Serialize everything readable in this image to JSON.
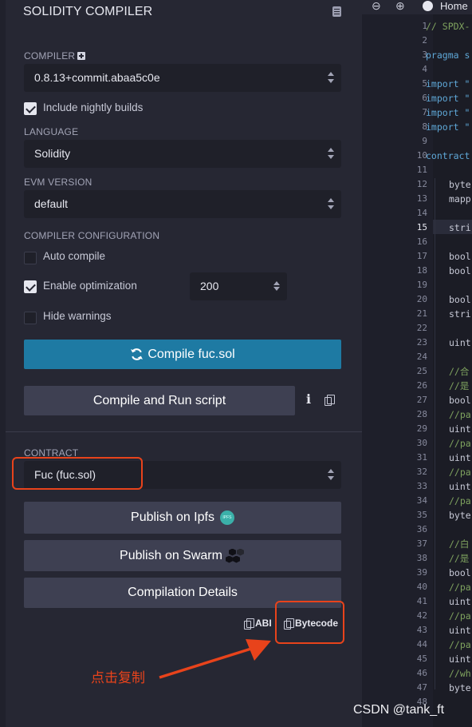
{
  "panel": {
    "title": "SOLIDITY COMPILER",
    "compiler_label": "COMPILER",
    "compiler_version": "0.8.13+commit.abaa5c0e",
    "include_nightly_label": "Include nightly builds",
    "language_label": "LANGUAGE",
    "language_value": "Solidity",
    "evm_label": "EVM VERSION",
    "evm_value": "default",
    "config_label": "COMPILER CONFIGURATION",
    "auto_compile_label": "Auto compile",
    "enable_optimization_label": "Enable optimization",
    "optimization_runs": "200",
    "hide_warnings_label": "Hide warnings",
    "compile_button": "Compile fuc.sol",
    "compile_run_button": "Compile and Run script",
    "info_icon_glyph": "i",
    "contract_label": "CONTRACT",
    "contract_value": "Fuc (fuc.sol)",
    "publish_ipfs_button": "Publish on Ipfs",
    "ipfs_badge_text": "IPFS",
    "publish_swarm_button": "Publish on Swarm",
    "compilation_details_button": "Compilation Details",
    "abi_label": "ABI",
    "bytecode_label": "Bytecode",
    "checks": {
      "include_nightly": true,
      "auto_compile": false,
      "enable_optimization": true,
      "hide_warnings": false
    }
  },
  "annotation": {
    "text": "点击复制",
    "color": "#e8431b"
  },
  "editor": {
    "line_numbers": [
      "1",
      "2",
      "3",
      "4",
      "5",
      "6",
      "7",
      "8",
      "9",
      "10",
      "11",
      "12",
      "13",
      "14",
      "15",
      "16",
      "17",
      "18",
      "19",
      "20",
      "21",
      "22",
      "23",
      "24",
      "25",
      "26",
      "27",
      "28",
      "29",
      "30",
      "31",
      "32",
      "33",
      "34",
      "35",
      "36",
      "37",
      "38",
      "39",
      "40",
      "41",
      "42",
      "43",
      "44",
      "45",
      "46",
      "47",
      "48"
    ],
    "current_line": "15",
    "code": {
      "l1": "// SPDX-",
      "l3": "pragma s",
      "l5": "import \"",
      "l6": "import \"",
      "l7": "import \"",
      "l8": "import \"",
      "l10": "contract",
      "l12": "byte",
      "l13": "mapp",
      "l15": "stri",
      "l17": "bool",
      "l18": "bool",
      "l20": "bool",
      "l21": "stri",
      "l23": "uint",
      "l25": "//合",
      "l26": "//是",
      "l27": "bool",
      "l28": "//pa",
      "l29": "uint",
      "l30": "//pa",
      "l31": "uint",
      "l32": "//pa",
      "l33": "uint",
      "l34": "//pa",
      "l35": "byte",
      "l37": "//白",
      "l38": "//是",
      "l39": "bool",
      "l40": "//pa",
      "l41": "uint",
      "l42": "//pa",
      "l43": "uint",
      "l44": "//pa",
      "l45": "uint",
      "l46": "//wh",
      "l47": "byte"
    },
    "toolbar": {
      "zoom_out": "⊖",
      "zoom_in": "⊕",
      "home_tab": "Home"
    }
  },
  "watermark": "CSDN @tank_ft",
  "colors": {
    "accent": "#1e7aa3",
    "highlight": "#e8431b"
  }
}
